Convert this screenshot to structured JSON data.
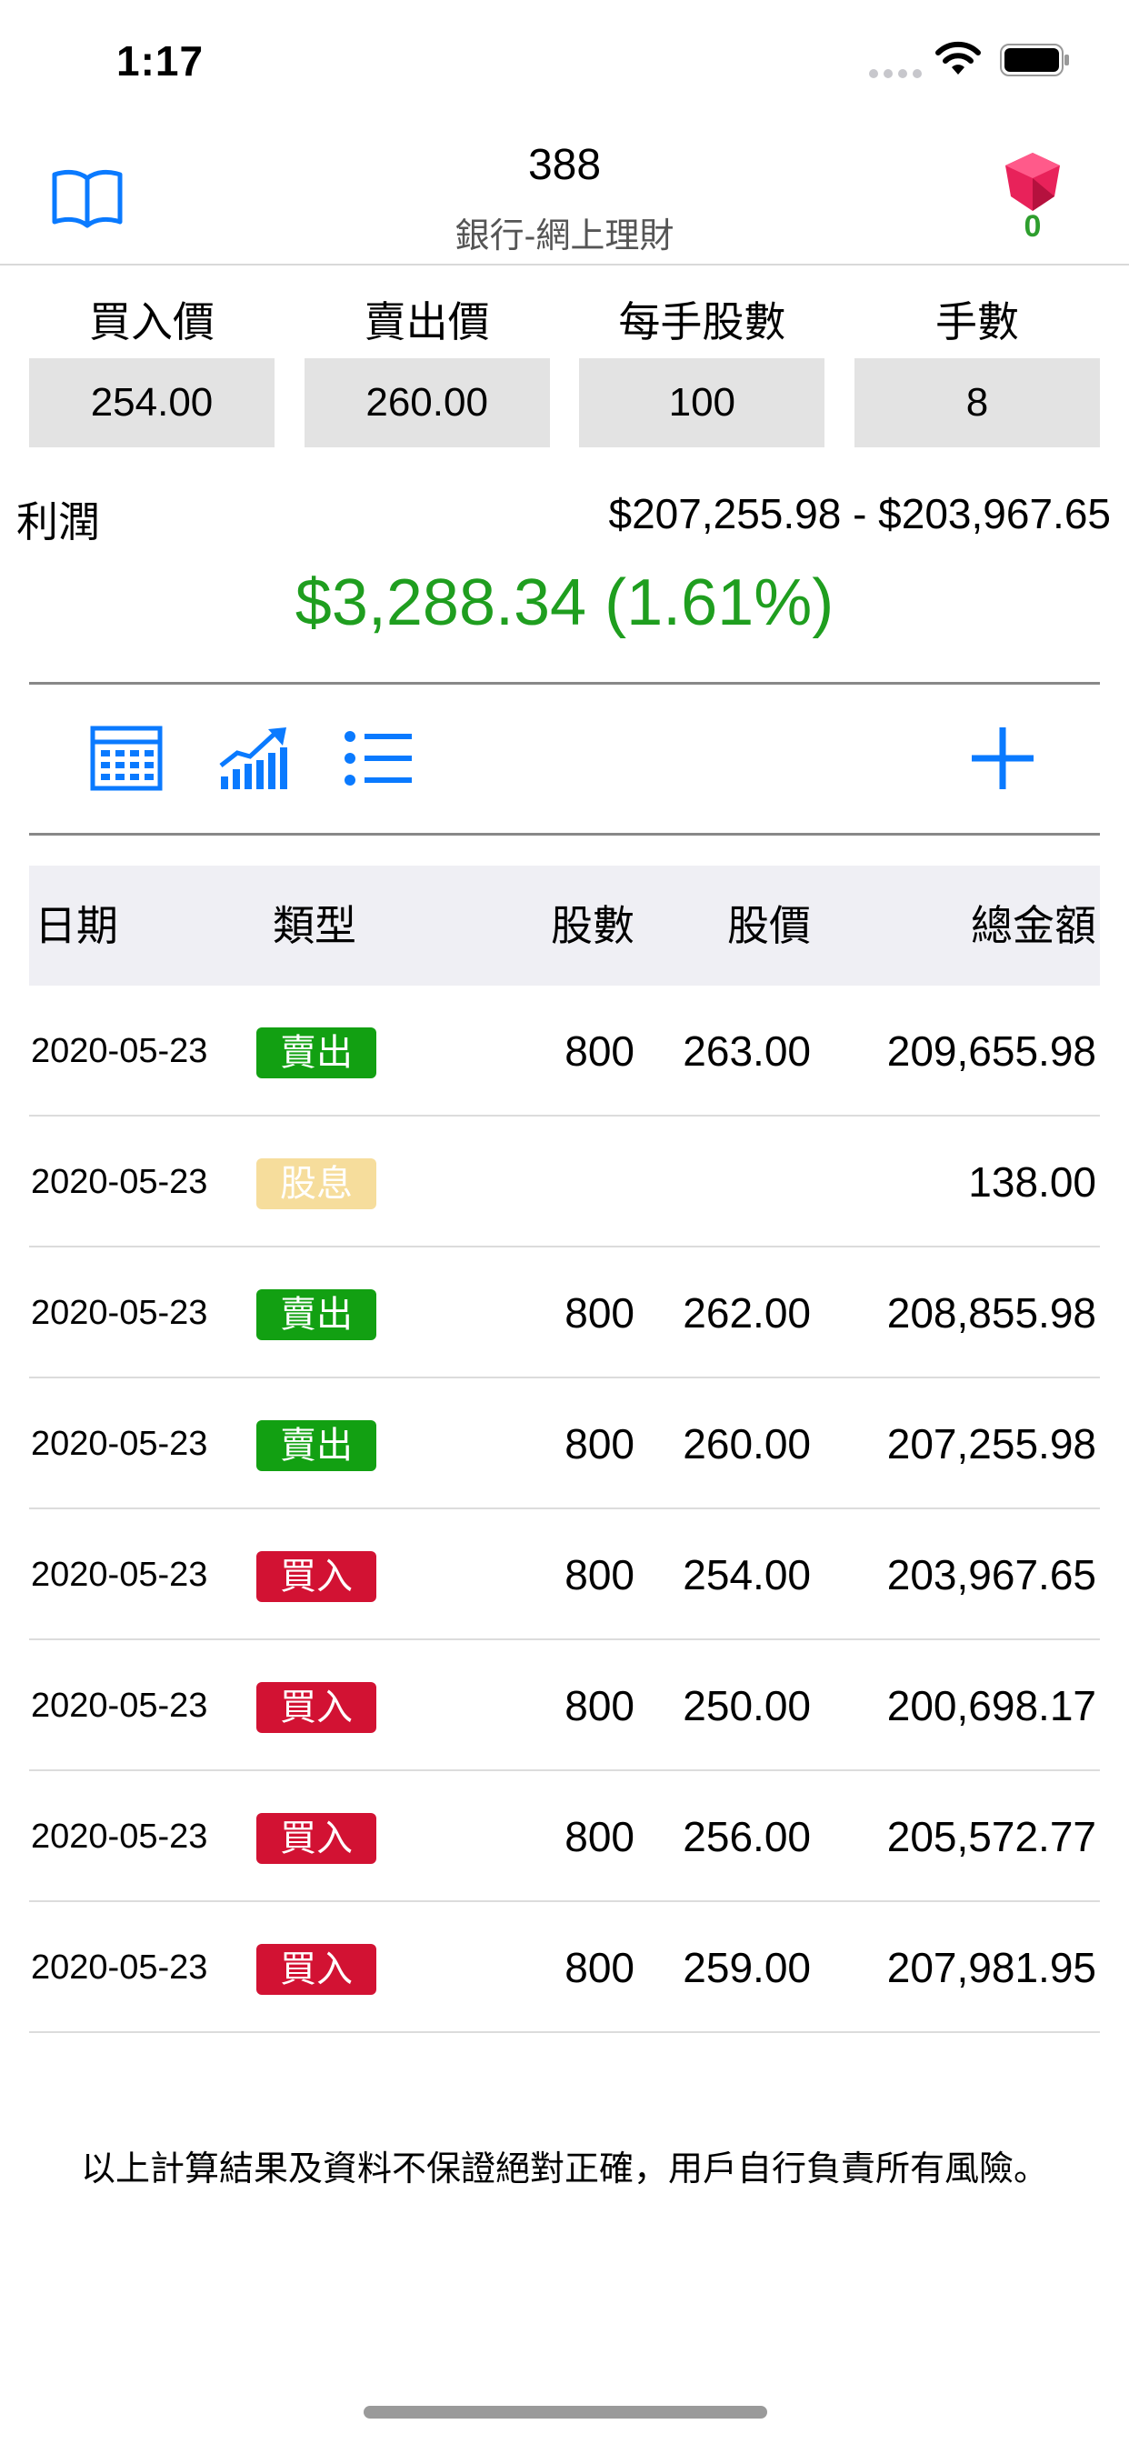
{
  "status_bar": {
    "time": "1:17"
  },
  "nav": {
    "title": "388",
    "subtitle": "銀行-網上理財",
    "gem_count": "0"
  },
  "inputs": [
    {
      "label": "買入價",
      "value": "254.00"
    },
    {
      "label": "賣出價",
      "value": "260.00"
    },
    {
      "label": "每手股數",
      "value": "100"
    },
    {
      "label": "手數",
      "value": "8"
    }
  ],
  "profit": {
    "label": "利潤",
    "range": "$207,255.98 - $203,967.65",
    "value": "$3,288.34 (1.61%)"
  },
  "toolbar": {
    "icons": [
      "calculator-grid-icon",
      "chart-bars-icon",
      "list-icon",
      "plus-icon"
    ],
    "accent_color": "#0a7aff"
  },
  "table": {
    "headers": {
      "date": "日期",
      "type": "類型",
      "shares": "股數",
      "price": "股價",
      "total": "總金額"
    },
    "rows": [
      {
        "date": "2020-05-23",
        "type": "賣出",
        "shares": "800",
        "price": "263.00",
        "total": "209,655.98"
      },
      {
        "date": "2020-05-23",
        "type": "股息",
        "shares": "",
        "price": "",
        "total": "138.00"
      },
      {
        "date": "2020-05-23",
        "type": "賣出",
        "shares": "800",
        "price": "262.00",
        "total": "208,855.98"
      },
      {
        "date": "2020-05-23",
        "type": "賣出",
        "shares": "800",
        "price": "260.00",
        "total": "207,255.98"
      },
      {
        "date": "2020-05-23",
        "type": "買入",
        "shares": "800",
        "price": "254.00",
        "total": "203,967.65"
      },
      {
        "date": "2020-05-23",
        "type": "買入",
        "shares": "800",
        "price": "250.00",
        "total": "200,698.17"
      },
      {
        "date": "2020-05-23",
        "type": "買入",
        "shares": "800",
        "price": "256.00",
        "total": "205,572.77"
      },
      {
        "date": "2020-05-23",
        "type": "買入",
        "shares": "800",
        "price": "259.00",
        "total": "207,981.95"
      }
    ],
    "badge_colors": {
      "sell": "#12a012",
      "dividend": "#f6dd9c",
      "buy": "#d21233"
    }
  },
  "disclaimer": "以上計算結果及資料不保證絕對正確，用戶自行負責所有風險。"
}
